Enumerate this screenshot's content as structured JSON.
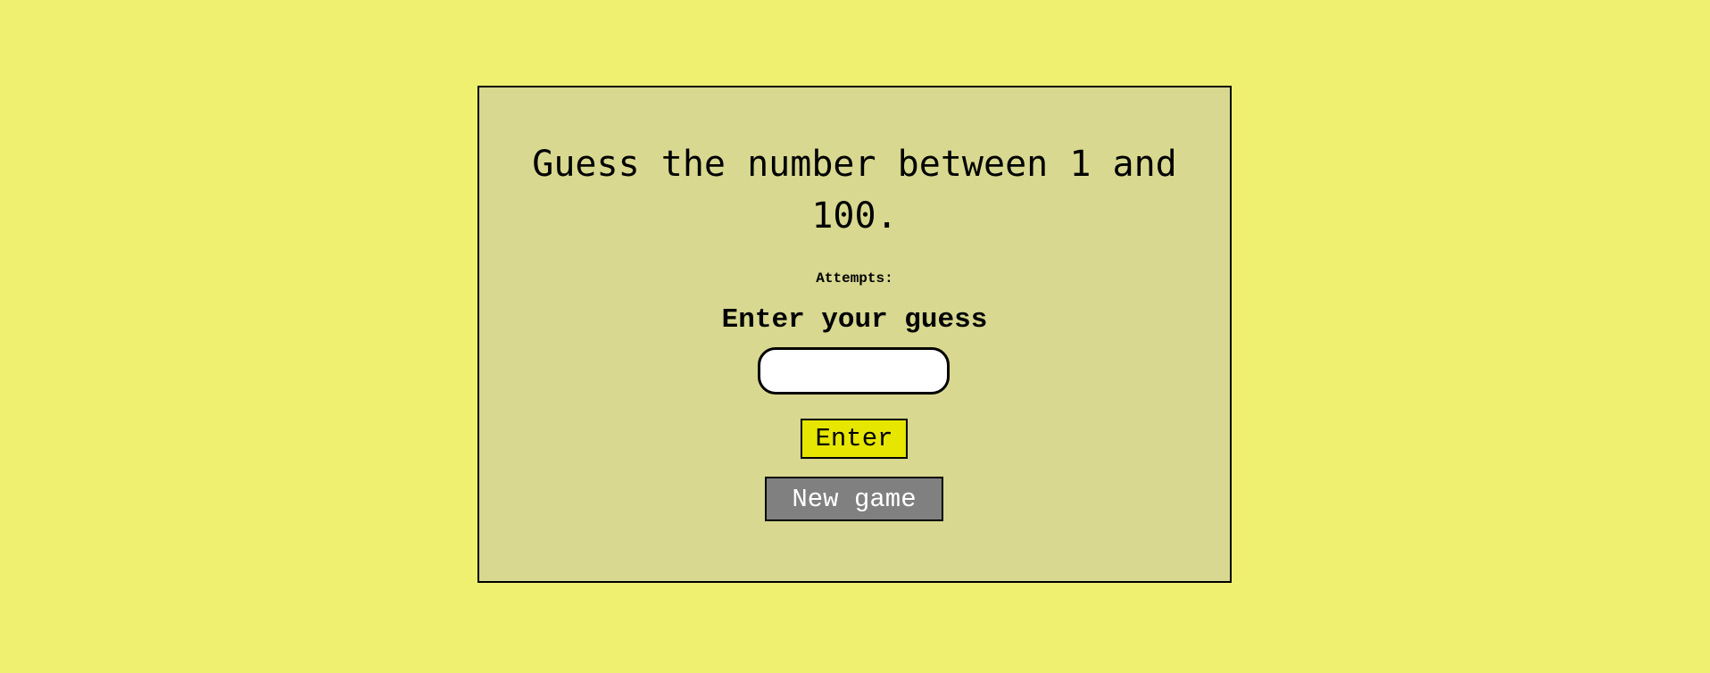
{
  "game": {
    "title": "Guess the number between 1 and 100.",
    "attempts_label": "Attempts:",
    "prompt": "Enter your guess",
    "guess_value": "",
    "enter_label": "Enter",
    "new_game_label": "New game"
  }
}
